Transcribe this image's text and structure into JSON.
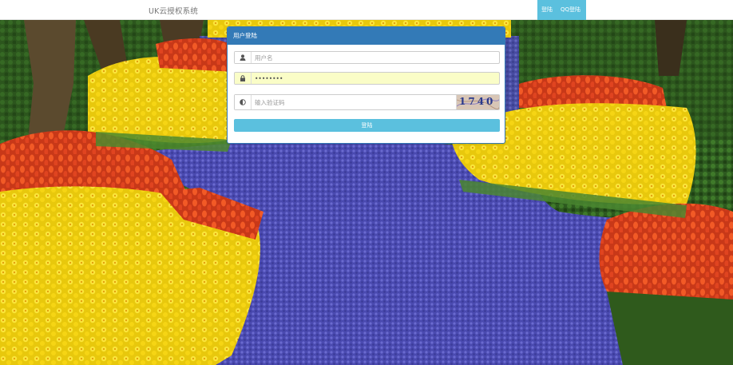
{
  "navbar": {
    "brand": "UK云授权系统",
    "links": [
      {
        "label": "登陆"
      },
      {
        "label": "QQ登陆"
      }
    ]
  },
  "login_panel": {
    "title": "用户登陆",
    "username": {
      "placeholder": "用户名",
      "value": "",
      "icon": "user-icon"
    },
    "password": {
      "placeholder": "",
      "value": "••••••••",
      "icon": "lock-icon"
    },
    "captcha": {
      "placeholder": "输入验证码",
      "value": "",
      "icon": "contrast-icon",
      "image_text": "1740"
    },
    "submit_label": "登陆"
  },
  "colors": {
    "primary": "#337ab7",
    "info": "#5bc0de",
    "autofill": "#fafdc7"
  }
}
